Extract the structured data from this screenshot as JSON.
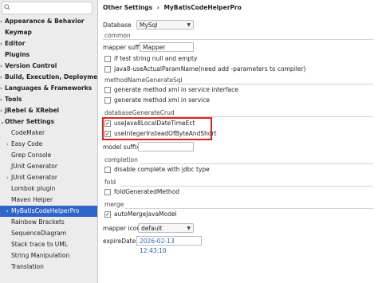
{
  "sidebar": {
    "items": [
      {
        "label": "Appearance & Behavior",
        "arrow": "›"
      },
      {
        "label": "Keymap",
        "arrow": ""
      },
      {
        "label": "Editor",
        "arrow": "›"
      },
      {
        "label": "Plugins",
        "arrow": ""
      },
      {
        "label": "Version Control",
        "arrow": "›"
      },
      {
        "label": "Build, Execution, Deployment",
        "arrow": "›"
      },
      {
        "label": "Languages & Frameworks",
        "arrow": "›"
      },
      {
        "label": "Tools",
        "arrow": "›"
      },
      {
        "label": "JRebel & XRebel",
        "arrow": "›"
      },
      {
        "label": "Other Settings",
        "arrow": "⌄"
      },
      {
        "label": "CodeMaker",
        "arrow": ""
      },
      {
        "label": "Easy Code",
        "arrow": "›"
      },
      {
        "label": "Grep Console",
        "arrow": ""
      },
      {
        "label": "JUnit Generator",
        "arrow": ""
      },
      {
        "label": "JUnit Generator",
        "arrow": "›"
      },
      {
        "label": "Lombok plugin",
        "arrow": ""
      },
      {
        "label": "Maven Helper",
        "arrow": ""
      },
      {
        "label": "MyBatisCodeHelperPro",
        "arrow": "›"
      },
      {
        "label": "Rainbow Brackets",
        "arrow": ""
      },
      {
        "label": "SequenceDiagram",
        "arrow": ""
      },
      {
        "label": "Stack trace to UML",
        "arrow": ""
      },
      {
        "label": "String Manipulation",
        "arrow": ""
      },
      {
        "label": "Translation",
        "arrow": ""
      }
    ]
  },
  "breadcrumb": {
    "parent": "Other Settings",
    "sep": "›",
    "current": "MyBatisCodeHelperPro"
  },
  "database": {
    "label": "Database",
    "value": "MySql"
  },
  "common": {
    "title": "common",
    "mapper_suffix_label": "mapper suffix",
    "mapper_suffix_value": "Mapper",
    "if_test_label": "if test string null and empty",
    "java8_label": "java8-useActualParamName(need add -parameters to compiler)"
  },
  "method_name": {
    "title": "methodNameGenerateSql",
    "opt1": "generate method xml in service interface",
    "opt2": "generate method xml in service"
  },
  "database_crud": {
    "title": "databaseGenerateCrud",
    "opt1": "useJava8LocalDateTimeEct",
    "opt2": "useIntegerInsteadOfByteAndShort",
    "model_suffix_label": "model suffix"
  },
  "completion": {
    "title": "completion",
    "opt1": "disable complete with jdbc type"
  },
  "fold": {
    "title": "fold",
    "opt1": "foldGeneratedMethod"
  },
  "merge": {
    "title": "merge",
    "opt1": "autoMergeJavaModel"
  },
  "mapper_icon": {
    "label": "mapper icon",
    "value": "default"
  },
  "expire": {
    "label": "expireDate",
    "value": "2026-02-13 12:43:10"
  },
  "colors": {
    "selection": "#2f65ca",
    "highlight_box": "#e02020",
    "date_text": "#2563c4"
  }
}
